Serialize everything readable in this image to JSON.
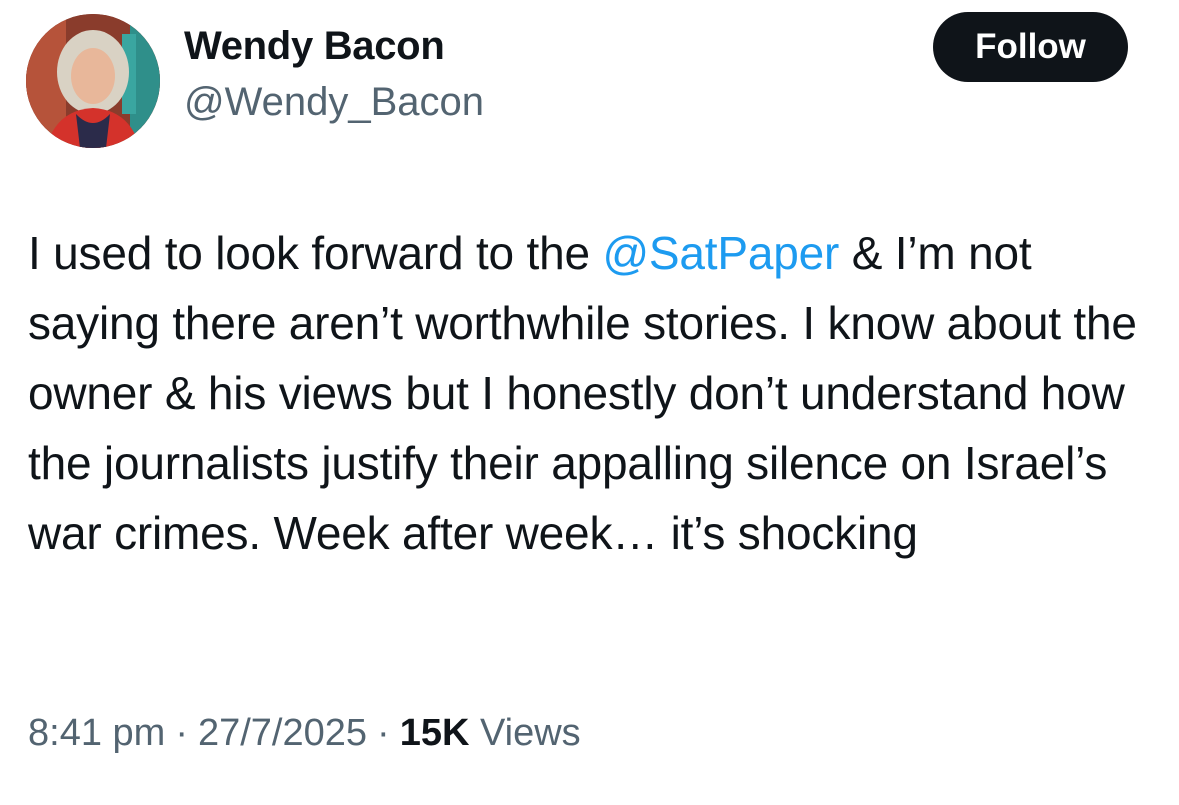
{
  "author": {
    "name": "Wendy Bacon",
    "handle": "@Wendy_Bacon"
  },
  "follow_label": "Follow",
  "tweet": {
    "text_before": "I used to look forward to the ",
    "mention": "@SatPaper",
    "text_after": " & I’m not saying there aren’t worthwhile stories. I know about the owner & his views but I honestly don’t understand how the journalists justify their appalling silence on Israel’s war crimes. Week after week… it’s shocking"
  },
  "meta": {
    "time": "8:41 pm",
    "date": "27/7/2025",
    "views_count": "15K",
    "views_label": "Views"
  },
  "colors": {
    "mention": "#1d9bf0",
    "secondary_text": "#536471",
    "primary_text": "#0f1419",
    "button_bg": "#0f1419"
  }
}
